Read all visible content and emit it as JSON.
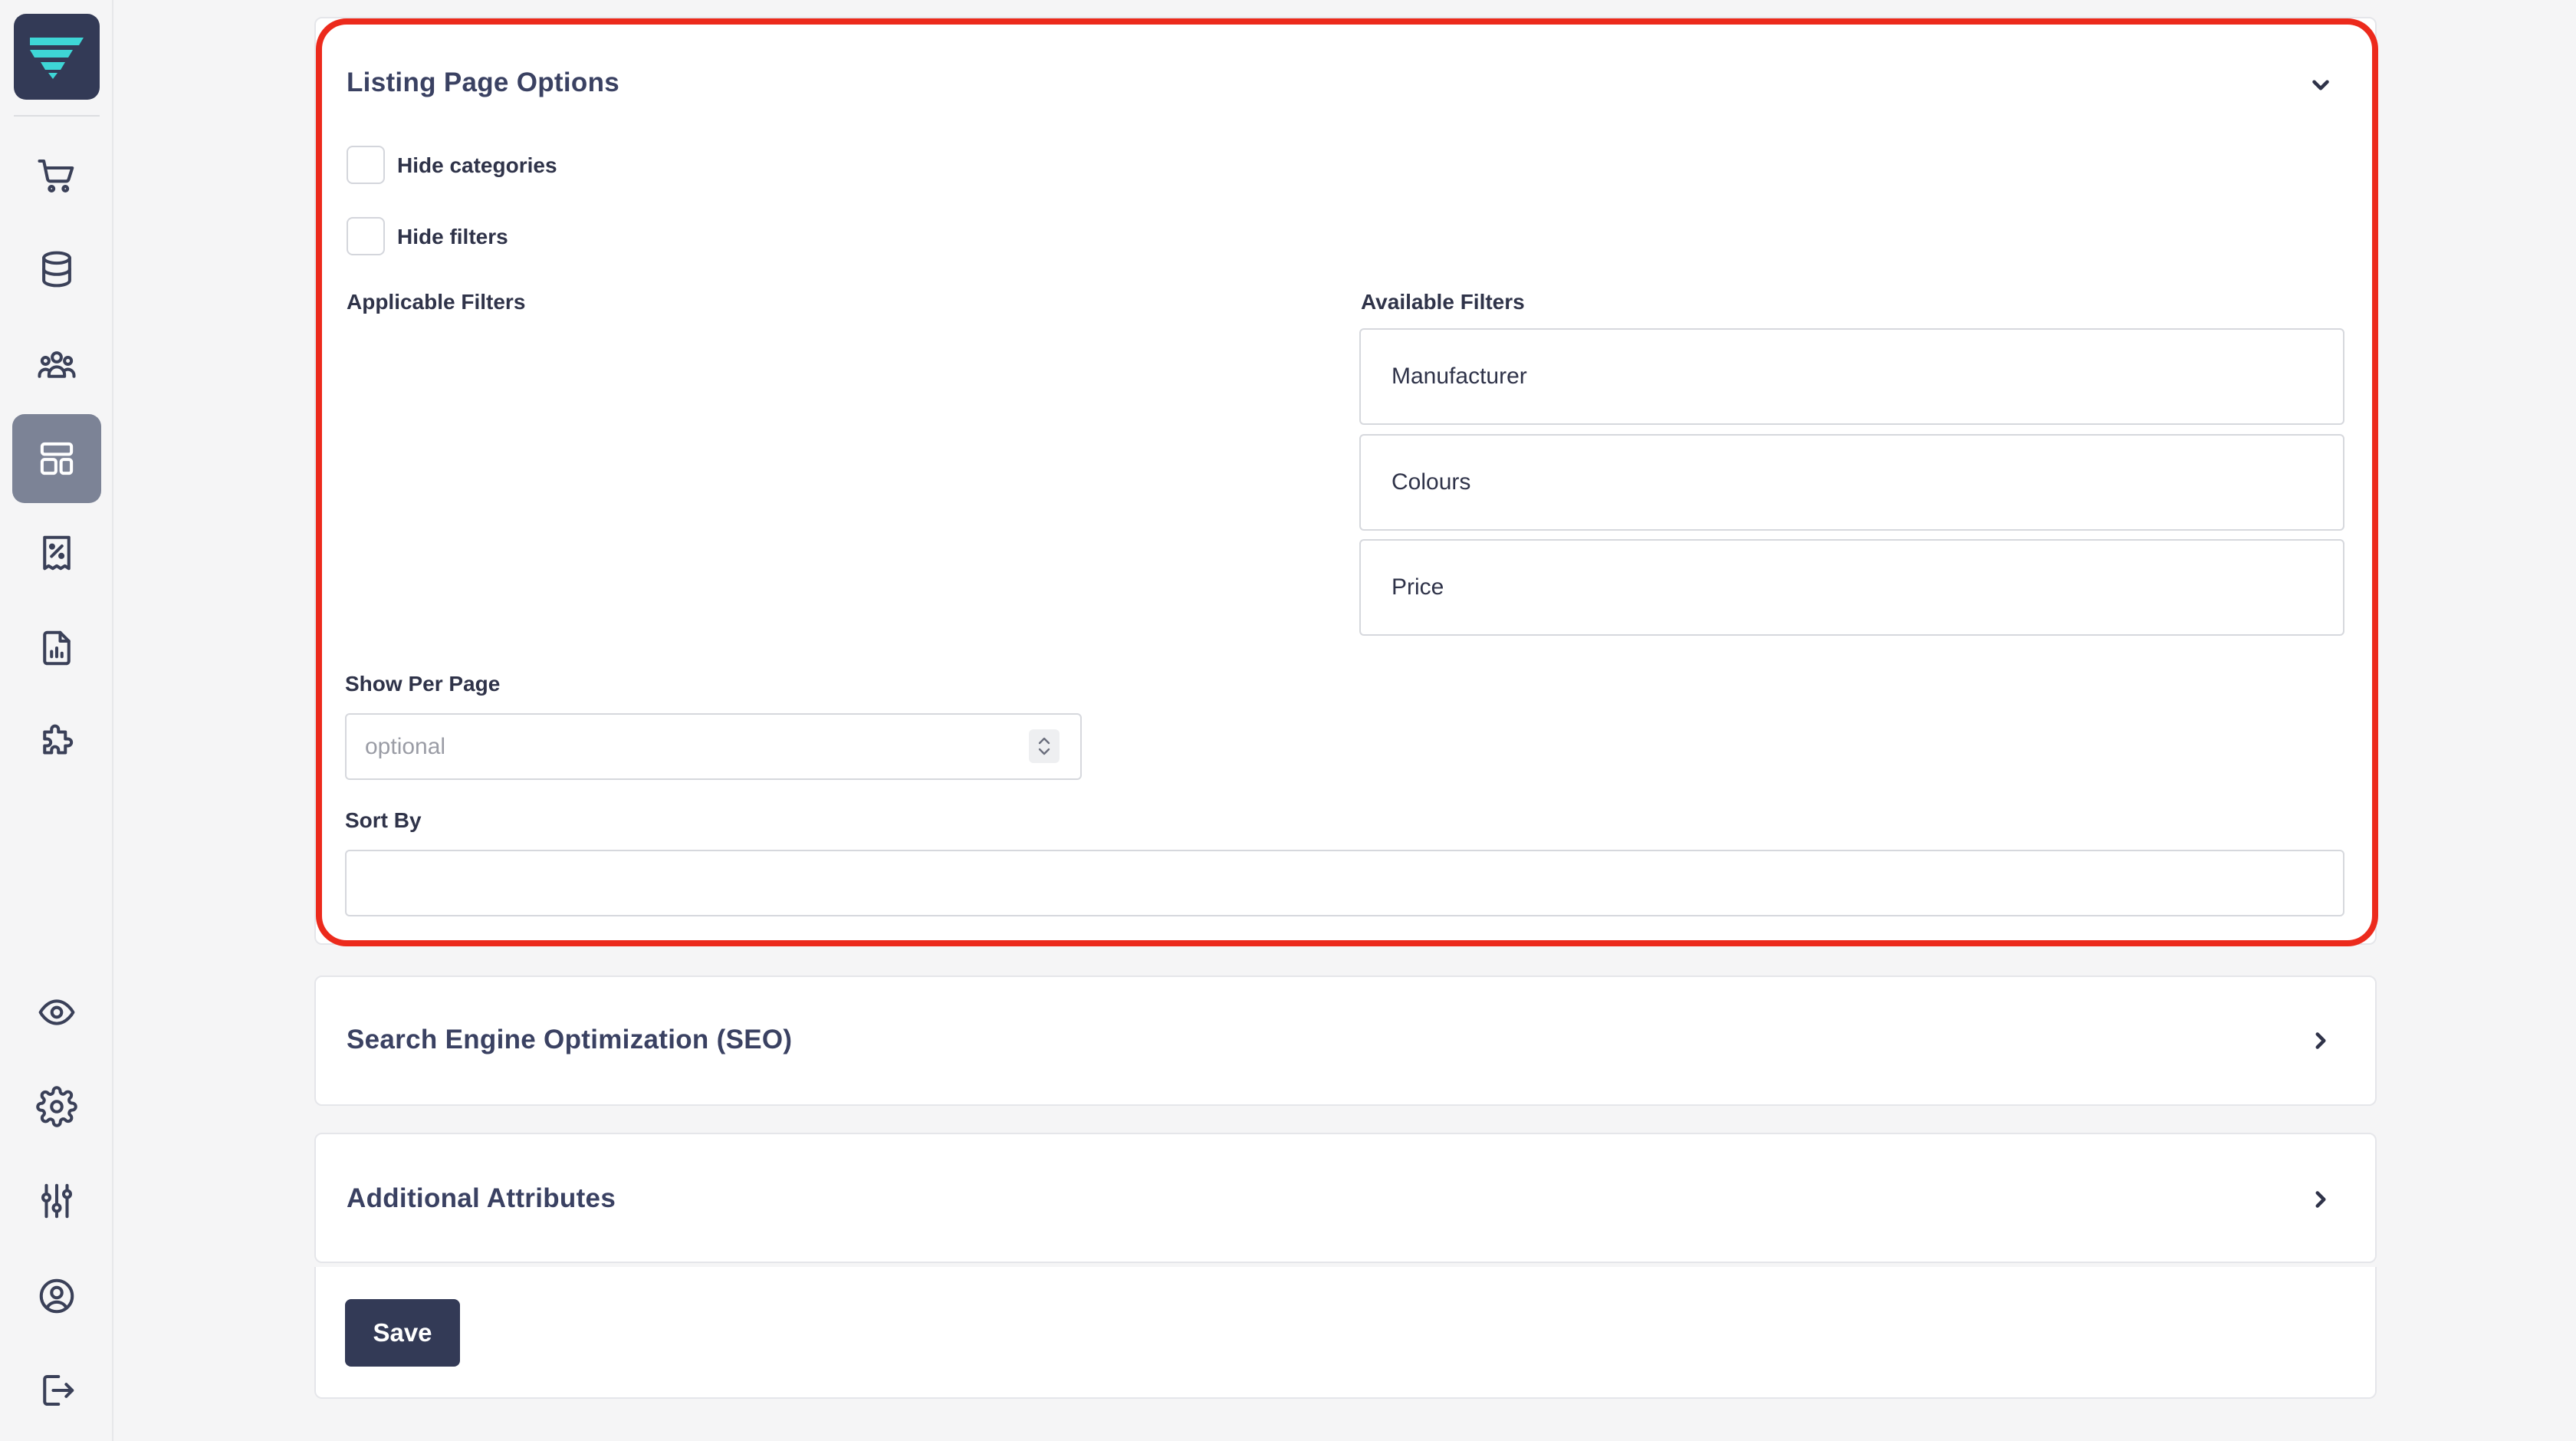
{
  "sidebar": {
    "logo_icon": "brand-logo-icon",
    "top_items": [
      {
        "icon": "cart-icon"
      },
      {
        "icon": "database-icon"
      },
      {
        "icon": "users-icon"
      },
      {
        "icon": "layout-icon",
        "active": true
      },
      {
        "icon": "receipt-percent-icon"
      },
      {
        "icon": "report-icon"
      },
      {
        "icon": "puzzle-icon"
      }
    ],
    "bottom_items": [
      {
        "icon": "eye-icon"
      },
      {
        "icon": "gear-icon"
      },
      {
        "icon": "sliders-icon"
      },
      {
        "icon": "user-circle-icon"
      },
      {
        "icon": "logout-icon"
      }
    ]
  },
  "listing": {
    "title": "Listing Page Options",
    "expanded": true,
    "hide_categories_label": "Hide categories",
    "hide_categories_checked": false,
    "hide_filters_label": "Hide filters",
    "hide_filters_checked": false,
    "applicable_filters_label": "Applicable Filters",
    "applicable_filters": [],
    "available_filters_label": "Available Filters",
    "available_filters": [
      "Manufacturer",
      "Colours",
      "Price"
    ],
    "show_per_page_label": "Show Per Page",
    "show_per_page_placeholder": "optional",
    "show_per_page_value": "",
    "sort_by_label": "Sort By",
    "sort_by_value": ""
  },
  "seo": {
    "title": "Search Engine Optimization (SEO)",
    "expanded": false
  },
  "additional": {
    "title": "Additional Attributes",
    "expanded": false
  },
  "actions": {
    "save_label": "Save"
  },
  "colors": {
    "brand_dark": "#333a56",
    "brand_accent": "#3ed6d6",
    "active_nav": "#7c8396",
    "highlight_border": "#ec2a1c"
  }
}
